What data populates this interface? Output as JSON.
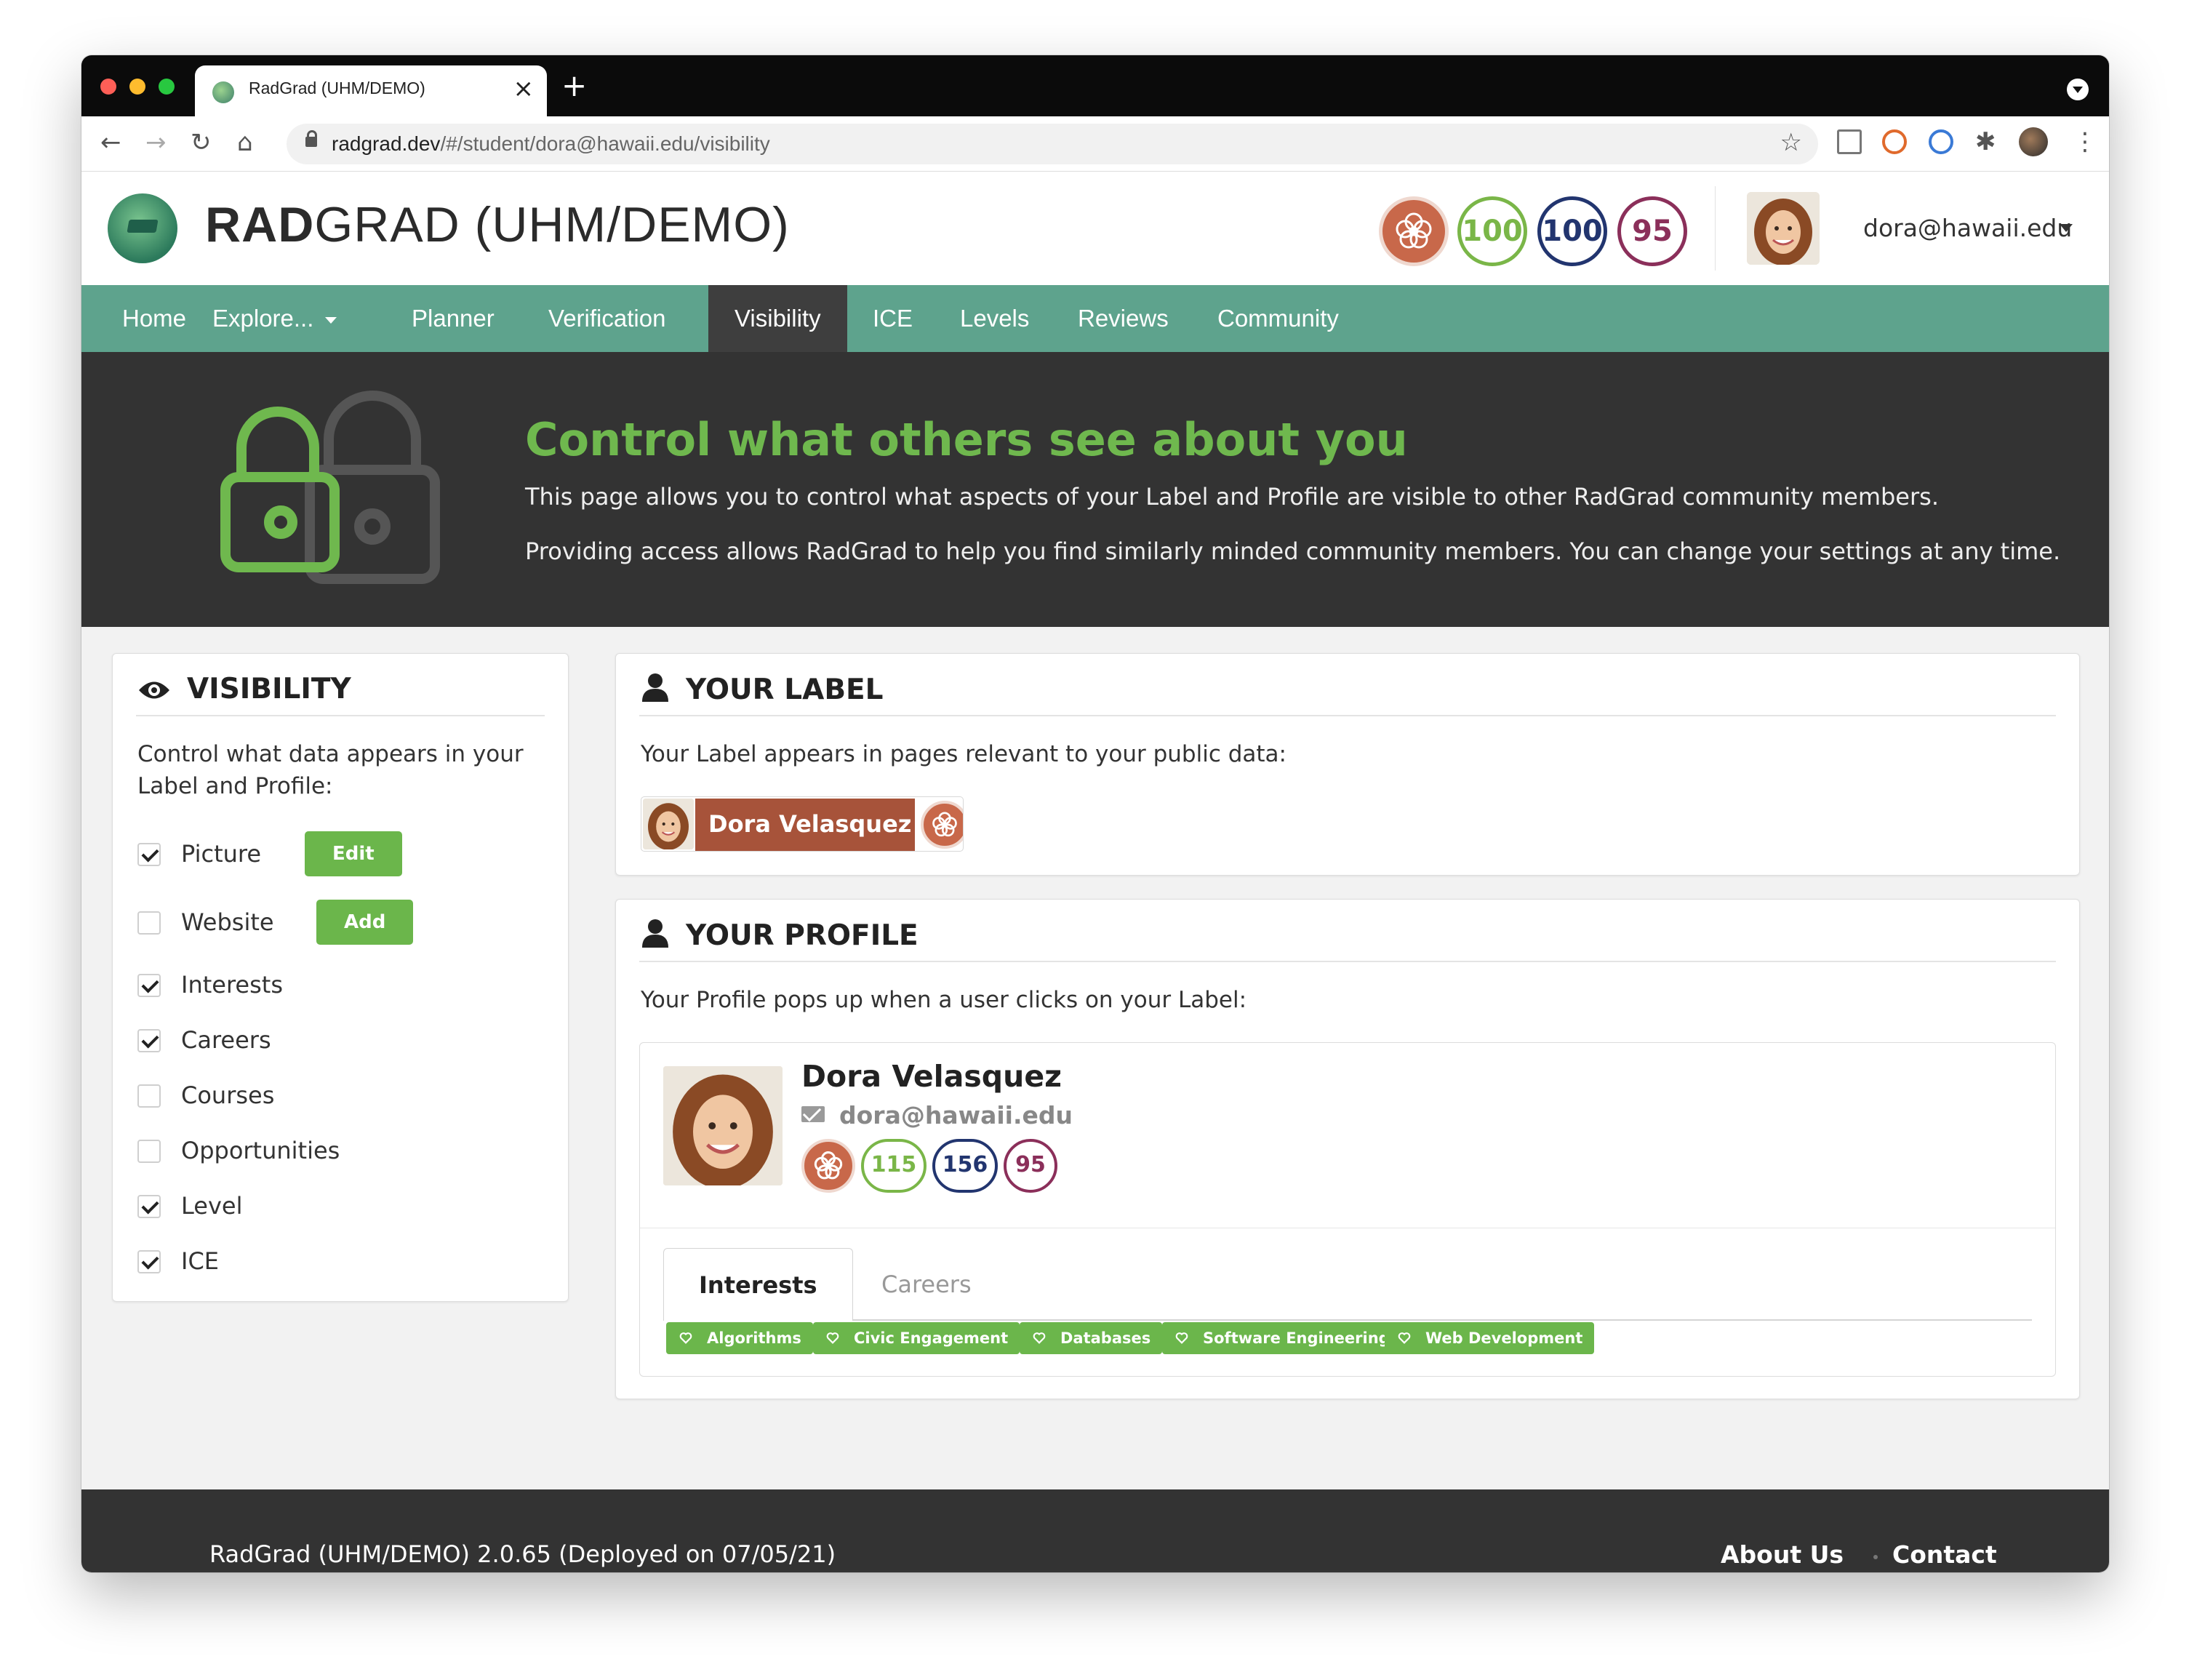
{
  "browser": {
    "tab_title": "RadGrad (UHM/DEMO)",
    "url_host": "radgrad.dev",
    "url_path": "/#/student/dora@hawaii.edu/visibility"
  },
  "header": {
    "brand_bold": "RAD",
    "brand_rest": "GRAD (UHM/DEMO)",
    "scores": {
      "innovation": "100",
      "competency": "100",
      "experience": "95"
    },
    "user_email": "dora@hawaii.edu"
  },
  "menu": {
    "items": [
      "Home",
      "Explore...",
      "Planner",
      "Verification",
      "Visibility",
      "ICE",
      "Levels",
      "Reviews",
      "Community"
    ],
    "active": "Visibility"
  },
  "banner": {
    "title": "Control what others see about you",
    "p1": "This page allows you to control what aspects of your Label and Profile are visible to other RadGrad community members.",
    "p2": "Providing access allows RadGrad to help you find similarly minded community members. You can change your settings at any time."
  },
  "visibility": {
    "title": "VISIBILITY",
    "intro_line1": "Control what data appears in your",
    "intro_line2": "Label and Profile:",
    "options": [
      {
        "label": "Picture",
        "checked": true,
        "button": "Edit"
      },
      {
        "label": "Website",
        "checked": false,
        "button": "Add"
      },
      {
        "label": "Interests",
        "checked": true
      },
      {
        "label": "Careers",
        "checked": true
      },
      {
        "label": "Courses",
        "checked": false
      },
      {
        "label": "Opportunities",
        "checked": false
      },
      {
        "label": "Level",
        "checked": true
      },
      {
        "label": "ICE",
        "checked": true
      }
    ]
  },
  "label_card": {
    "title": "YOUR LABEL",
    "text": "Your Label appears in pages relevant to your public data:",
    "name": "Dora Velasquez"
  },
  "profile_card": {
    "title": "YOUR PROFILE",
    "text": "Your Profile pops up when a user clicks on your Label:",
    "name": "Dora Velasquez",
    "email": "dora@hawaii.edu",
    "scores": {
      "innovation": "115",
      "competency": "156",
      "experience": "95"
    },
    "tabs": [
      "Interests",
      "Careers"
    ],
    "active_tab": "Interests",
    "interests": [
      "Algorithms",
      "Civic Engagement",
      "Databases",
      "Software Engineering",
      "Web Development"
    ]
  },
  "footer": {
    "version": "RadGrad (UHM/DEMO) 2.0.65 (Deployed on 07/05/21)",
    "about": "About Us",
    "contact": "Contact"
  },
  "colors": {
    "menu_green": "#5ea38d",
    "banner_dark": "#333333",
    "accent_green": "#6bb64b",
    "label_brown": "#a7533a",
    "innovation": "#7ab648",
    "competency": "#22356f",
    "experience": "#8b2f5a"
  }
}
